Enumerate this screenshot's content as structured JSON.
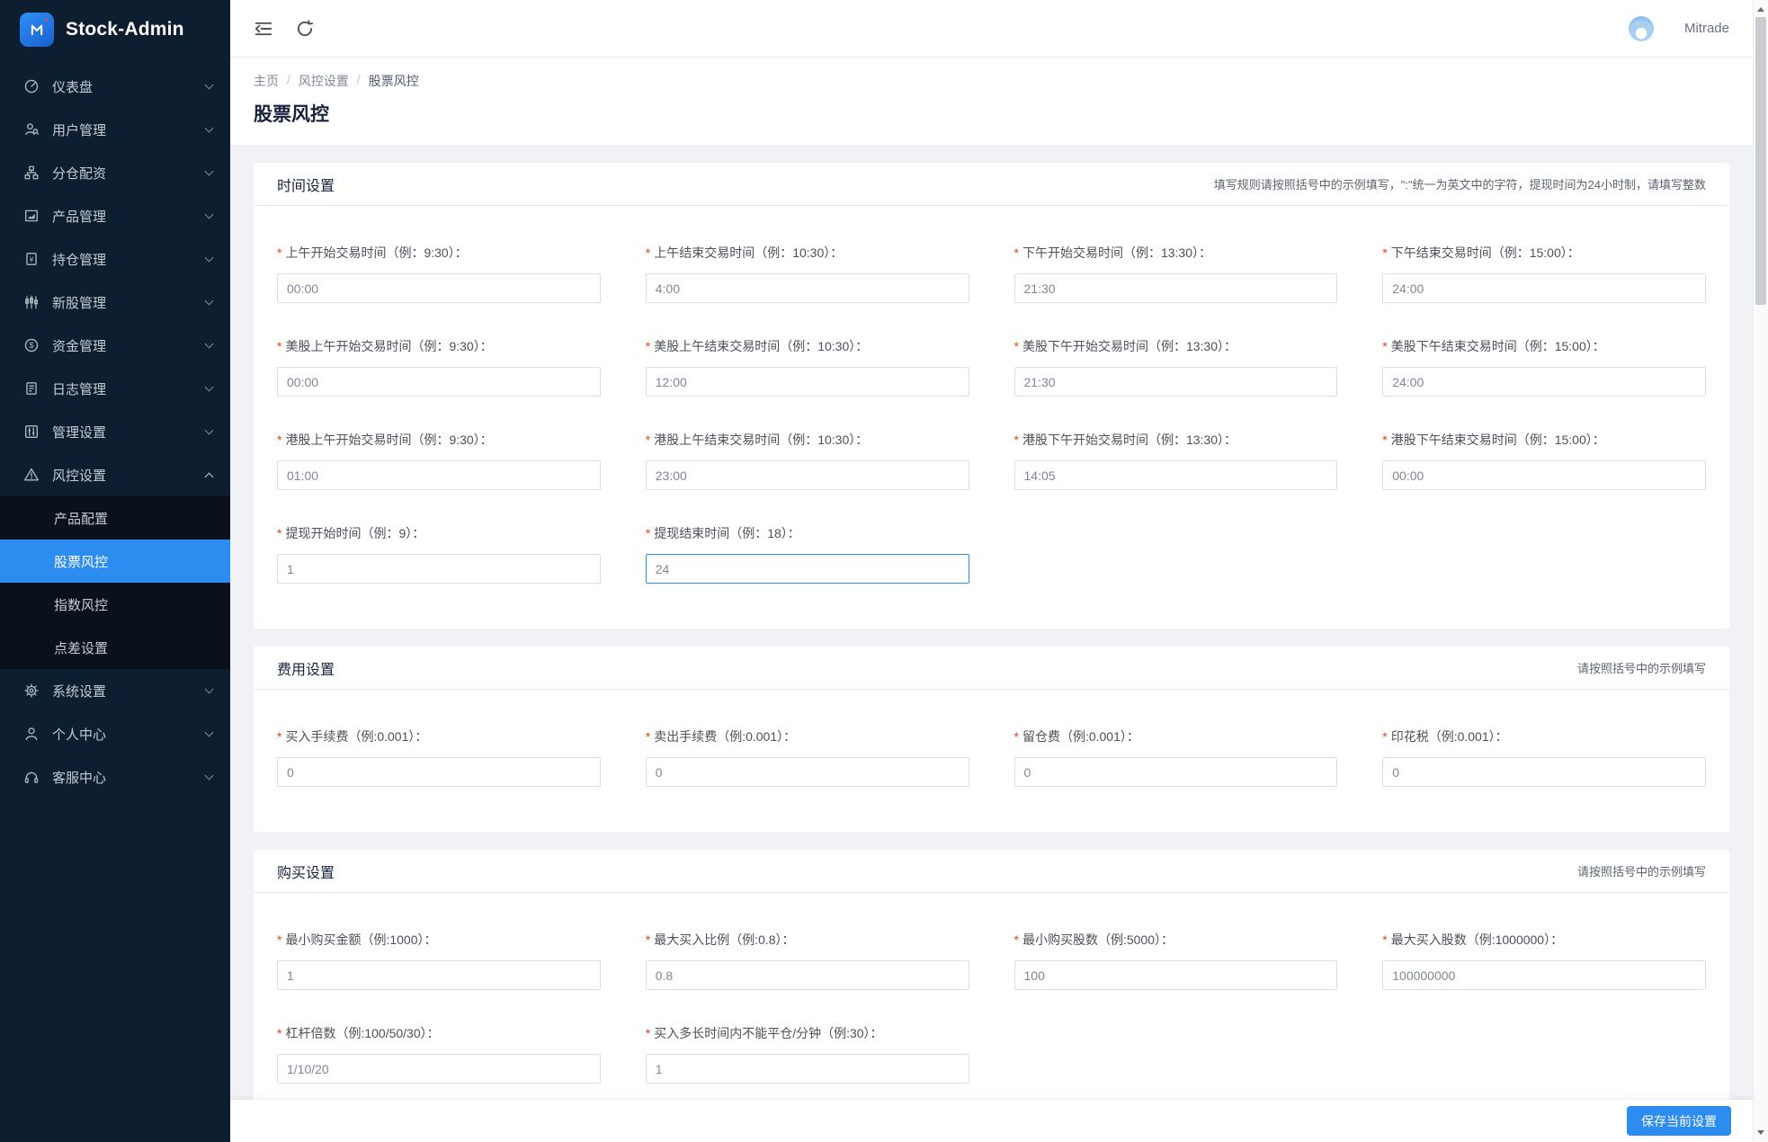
{
  "app": {
    "logo_text": "Stock-Admin",
    "user_name": "Mitrade"
  },
  "colors": {
    "sidebar_bg": "#0d1e30",
    "submenu_bg": "#0a101c",
    "accent_blue": "#2d8cf0",
    "required_red": "#ed4014",
    "content_bg": "#f0f2f5"
  },
  "sidebar": {
    "items": [
      {
        "label": "仪表盘",
        "icon": "gauge-icon"
      },
      {
        "label": "用户管理",
        "icon": "user-search-icon"
      },
      {
        "label": "分仓配资",
        "icon": "org-chart-icon"
      },
      {
        "label": "产品管理",
        "icon": "chart-icon"
      },
      {
        "label": "持仓管理",
        "icon": "position-icon"
      },
      {
        "label": "新股管理",
        "icon": "candlestick-icon"
      },
      {
        "label": "资金管理",
        "icon": "dollar-icon"
      },
      {
        "label": "日志管理",
        "icon": "log-icon"
      },
      {
        "label": "管理设置",
        "icon": "sliders-icon"
      },
      {
        "label": "风控设置",
        "icon": "warning-icon",
        "expanded": true,
        "children": [
          {
            "label": "产品配置"
          },
          {
            "label": "股票风控",
            "active": true
          },
          {
            "label": "指数风控"
          },
          {
            "label": "点差设置"
          }
        ]
      },
      {
        "label": "系统设置",
        "icon": "gear-icon"
      },
      {
        "label": "个人中心",
        "icon": "person-icon"
      },
      {
        "label": "客服中心",
        "icon": "headset-icon"
      }
    ]
  },
  "breadcrumb": {
    "items": [
      "主页",
      "风控设置",
      "股票风控"
    ]
  },
  "page_title": "股票风控",
  "sections": [
    {
      "title": "时间设置",
      "note": "填写规则请按照括号中的示例填写，\":\"统一为英文中的字符，提现时间为24小时制，请填写整数",
      "fields": [
        {
          "label": "上午开始交易时间（例：9:30）：",
          "value": "00:00"
        },
        {
          "label": "上午结束交易时间（例：10:30）：",
          "value": "4:00"
        },
        {
          "label": "下午开始交易时间（例：13:30）：",
          "value": "21:30"
        },
        {
          "label": "下午结束交易时间（例：15:00）：",
          "value": "24:00"
        },
        {
          "label": "美股上午开始交易时间（例：9:30）：",
          "value": "00:00"
        },
        {
          "label": "美股上午结束交易时间（例：10:30）：",
          "value": "12:00"
        },
        {
          "label": "美股下午开始交易时间（例：13:30）：",
          "value": "21:30"
        },
        {
          "label": "美股下午结束交易时间（例：15:00）：",
          "value": "24:00"
        },
        {
          "label": "港股上午开始交易时间（例：9:30）：",
          "value": "01:00"
        },
        {
          "label": "港股上午结束交易时间（例：10:30）：",
          "value": "23:00"
        },
        {
          "label": "港股下午开始交易时间（例：13:30）：",
          "value": "14:05"
        },
        {
          "label": "港股下午结束交易时间（例：15:00）：",
          "value": "00:00"
        },
        {
          "label": "提现开始时间（例：9）：",
          "value": "1"
        },
        {
          "label": "提现结束时间（例：18）：",
          "value": "24",
          "focused": true
        }
      ]
    },
    {
      "title": "费用设置",
      "note": "请按照括号中的示例填写",
      "fields": [
        {
          "label": "买入手续费（例:0.001）：",
          "value": "0"
        },
        {
          "label": "卖出手续费（例:0.001）：",
          "value": "0"
        },
        {
          "label": "留仓费（例:0.001）：",
          "value": "0"
        },
        {
          "label": "印花税（例:0.001）：",
          "value": "0"
        }
      ]
    },
    {
      "title": "购买设置",
      "note": "请按照括号中的示例填写",
      "fields": [
        {
          "label": "最小购买金额（例:1000）：",
          "value": "1"
        },
        {
          "label": "最大买入比例（例:0.8）：",
          "value": "0.8"
        },
        {
          "label": "最小购买股数（例:5000）：",
          "value": "100"
        },
        {
          "label": "最大买入股数（例:1000000）：",
          "value": "100000000"
        },
        {
          "label": "杠杆倍数（例:100/50/30）：",
          "value": "1/10/20"
        },
        {
          "label": "买入多长时间内不能平仓/分钟（例:30）：",
          "value": "1"
        }
      ]
    }
  ],
  "footer": {
    "save_label": "保存当前设置"
  }
}
